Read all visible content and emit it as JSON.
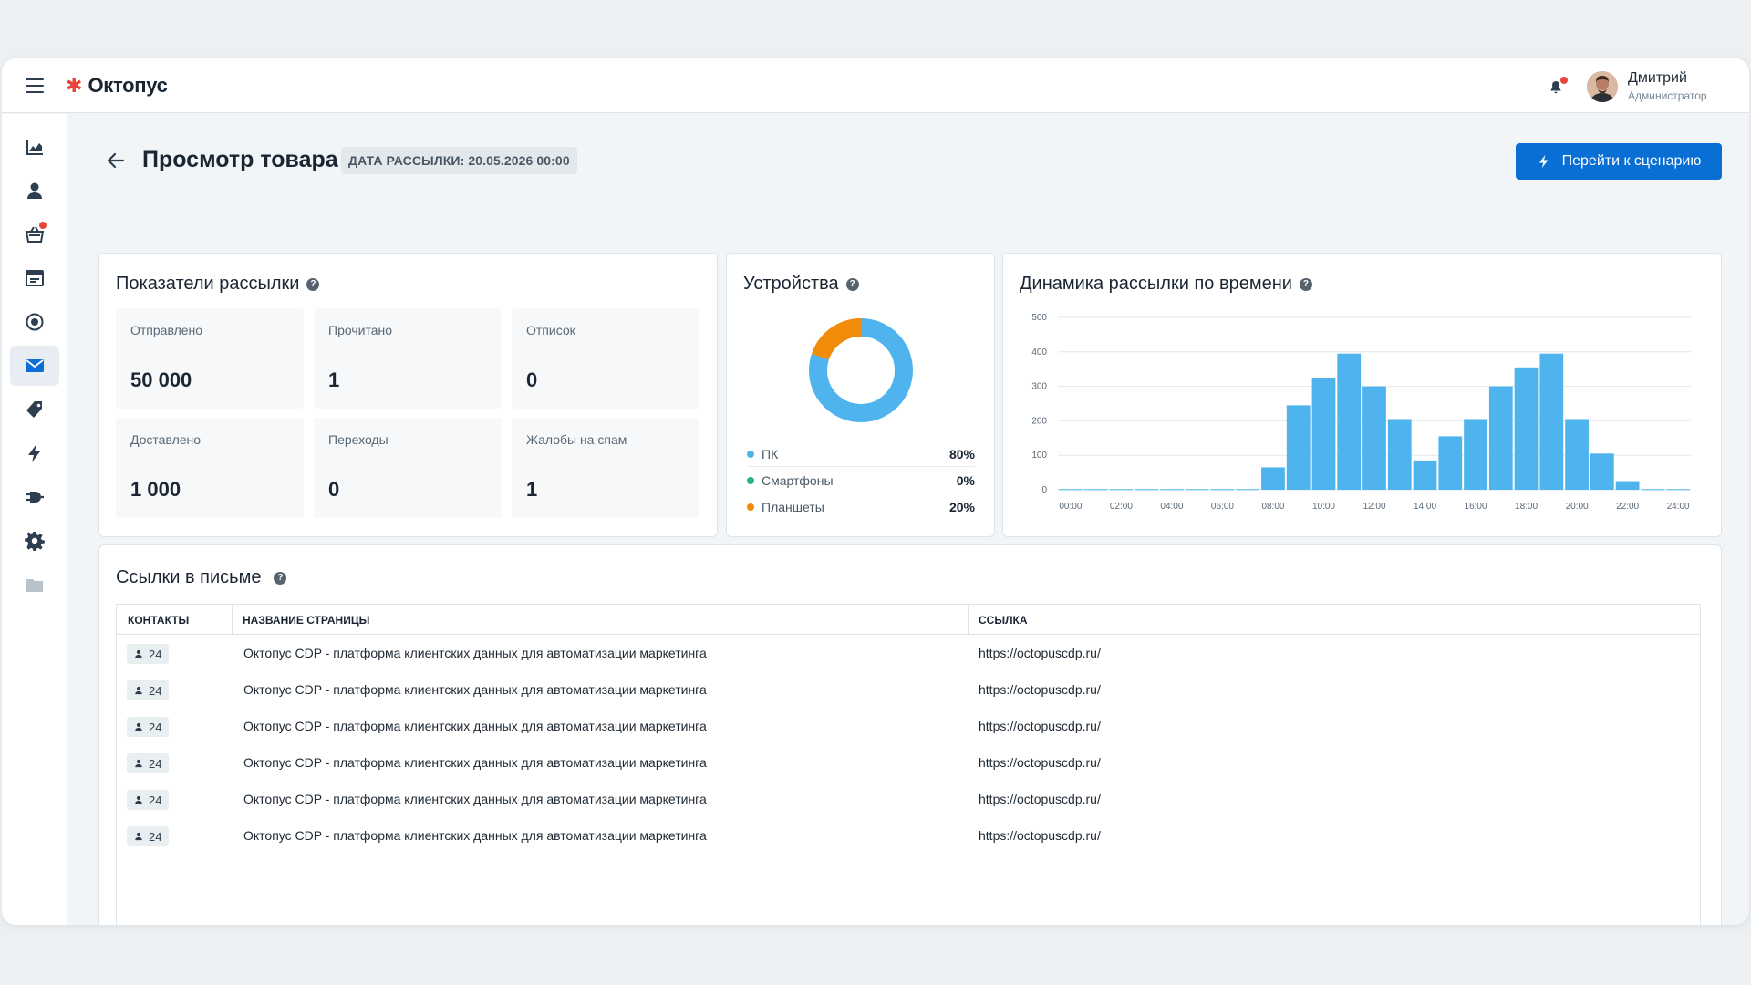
{
  "app": {
    "brand": "Октопус",
    "brand_mark": "✱",
    "user": {
      "name": "Дмитрий",
      "role": "Администратор"
    },
    "accent_color": "#0a6fd4",
    "notification_color": "#e5453b"
  },
  "sidebar": {
    "items": [
      {
        "icon": "chart-area-icon",
        "active": false
      },
      {
        "icon": "user-icon",
        "active": false
      },
      {
        "icon": "basket-icon",
        "active": false,
        "badge": true
      },
      {
        "icon": "calendar-icon",
        "active": false
      },
      {
        "icon": "target-icon",
        "active": false
      },
      {
        "icon": "mail-icon",
        "active": true
      },
      {
        "icon": "tag-icon",
        "active": false
      },
      {
        "icon": "bolt-icon",
        "active": false
      },
      {
        "icon": "plug-icon",
        "active": false
      },
      {
        "icon": "gear-icon",
        "active": false
      },
      {
        "icon": "folder-icon",
        "active": false
      }
    ]
  },
  "header": {
    "title": "Просмотр товара",
    "date_badge": "ДАТА РАССЫЛКИ: 20.05.2026 00:00",
    "action_button": "Перейти к сценарию"
  },
  "metrics": {
    "title": "Показатели рассылки",
    "help": "?",
    "items": [
      {
        "label": "Отправлено",
        "value": "50 000"
      },
      {
        "label": "Прочитано",
        "value": "1"
      },
      {
        "label": "Отписок",
        "value": "0"
      },
      {
        "label": "Доставлено",
        "value": "1 000"
      },
      {
        "label": "Переходы",
        "value": "0"
      },
      {
        "label": "Жалобы на спам",
        "value": "1"
      }
    ]
  },
  "devices": {
    "title": "Устройства",
    "help": "?",
    "items": [
      {
        "label": "ПК",
        "percent": "80%",
        "value": 80,
        "color": "#4fb3ee"
      },
      {
        "label": "Смартфоны",
        "percent": "0%",
        "value": 0,
        "color": "#21b38a"
      },
      {
        "label": "Планшеты",
        "percent": "20%",
        "value": 20,
        "color": "#f08c0a"
      }
    ]
  },
  "dynamics": {
    "title": "Динамика рассылки по времени",
    "help": "?"
  },
  "chart_data": {
    "type": "bar",
    "title": "Динамика рассылки по времени",
    "xlabel": "",
    "ylabel": "",
    "ylim": [
      0,
      500
    ],
    "y_ticks": [
      0,
      100,
      200,
      300,
      400,
      500
    ],
    "x_tick_labels": [
      "00:00",
      "02:00",
      "04:00",
      "06:00",
      "08:00",
      "10:00",
      "12:00",
      "14:00",
      "16:00",
      "18:00",
      "20:00",
      "22:00",
      "24:00"
    ],
    "categories": [
      "00:00",
      "01:00",
      "02:00",
      "03:00",
      "04:00",
      "05:00",
      "06:00",
      "07:00",
      "08:00",
      "09:00",
      "10:00",
      "11:00",
      "12:00",
      "13:00",
      "14:00",
      "15:00",
      "16:00",
      "17:00",
      "18:00",
      "19:00",
      "20:00",
      "21:00",
      "22:00",
      "23:00",
      "24:00"
    ],
    "values": [
      2,
      2,
      2,
      2,
      2,
      2,
      2,
      2,
      65,
      245,
      325,
      395,
      300,
      205,
      85,
      155,
      205,
      300,
      355,
      395,
      205,
      105,
      25,
      2,
      2
    ],
    "grid": true,
    "bar_color": "#4fb3ee"
  },
  "links": {
    "title": "Ссылки в письме",
    "help": "?",
    "columns": [
      "КОНТАКТЫ",
      "НАЗВАНИЕ СТРАНИЦЫ",
      "ССЫЛКА"
    ],
    "rows": [
      {
        "contacts": "24",
        "name": "Октопус CDP - платформа клиентских данных для автоматизации маркетинга",
        "url": "https://octopuscdp.ru/"
      },
      {
        "contacts": "24",
        "name": "Октопус CDP - платформа клиентских данных для автоматизации маркетинга",
        "url": "https://octopuscdp.ru/"
      },
      {
        "contacts": "24",
        "name": "Октопус CDP - платформа клиентских данных для автоматизации маркетинга",
        "url": "https://octopuscdp.ru/"
      },
      {
        "contacts": "24",
        "name": "Октопус CDP - платформа клиентских данных для автоматизации маркетинга",
        "url": "https://octopuscdp.ru/"
      },
      {
        "contacts": "24",
        "name": "Октопус CDP - платформа клиентских данных для автоматизации маркетинга",
        "url": "https://octopuscdp.ru/"
      },
      {
        "contacts": "24",
        "name": "Октопус CDP - платформа клиентских данных для автоматизации маркетинга",
        "url": "https://octopuscdp.ru/"
      }
    ]
  }
}
